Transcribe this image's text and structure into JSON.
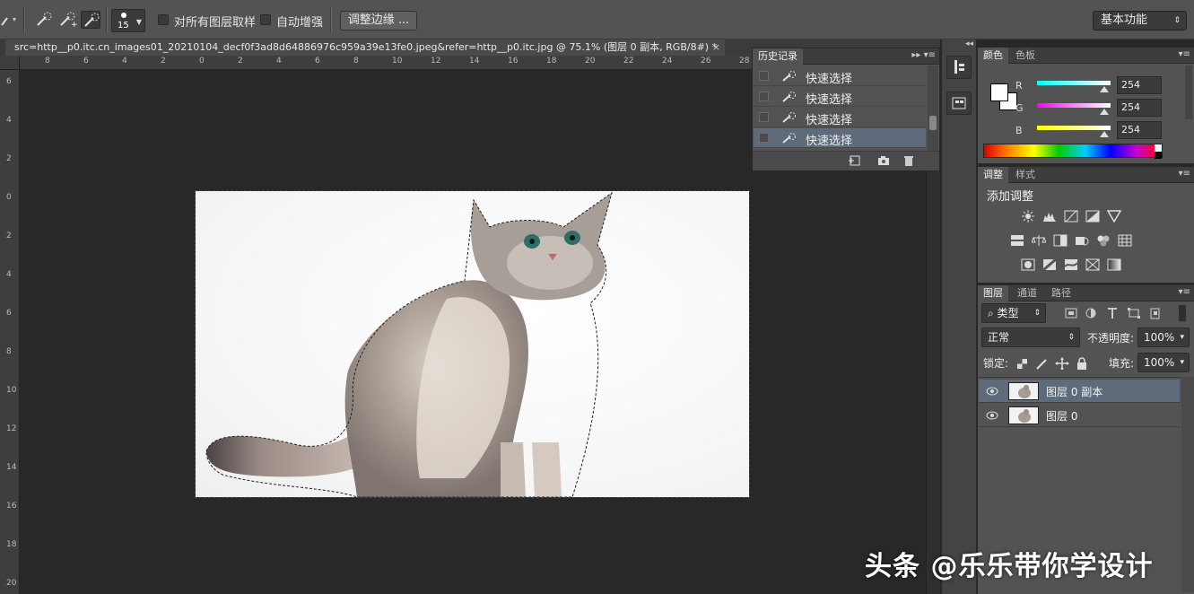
{
  "options_bar": {
    "brush_size": "15",
    "sample_all_layers_label": "对所有图层取样",
    "auto_enhance_label": "自动增强",
    "refine_edge_label": "调整边缘 ...",
    "workspace_label": "基本功能"
  },
  "document": {
    "tab_title": "src=http__p0.itc.cn_images01_20210104_decf0f3ad8d64886976c959a39e13fe0.jpeg&refer=http__p0.itc.jpg @ 75.1% (图层 0 副本, RGB/8#) *",
    "close_glyph": "×",
    "ruler_h": [
      "8",
      "6",
      "4",
      "2",
      "0",
      "2",
      "4",
      "6",
      "8",
      "10",
      "12",
      "14",
      "16",
      "18",
      "20",
      "22",
      "24",
      "26",
      "28"
    ],
    "ruler_v": [
      "6",
      "4",
      "2",
      "0",
      "2",
      "4",
      "6",
      "8",
      "10",
      "12",
      "14",
      "16",
      "18",
      "20"
    ]
  },
  "history": {
    "tab_label": "历史记录",
    "items": [
      "快速选择",
      "快速选择",
      "快速选择",
      "快速选择"
    ],
    "selected_index": 3
  },
  "color": {
    "tabs": [
      "颜色",
      "色板"
    ],
    "channels": [
      {
        "name": "R",
        "value": "254"
      },
      {
        "name": "G",
        "value": "254"
      },
      {
        "name": "B",
        "value": "254"
      }
    ]
  },
  "adjustments": {
    "tabs": [
      "调整",
      "样式"
    ],
    "title": "添加调整"
  },
  "layers": {
    "tabs": [
      "图层",
      "通道",
      "路径"
    ],
    "filter_label": "类型",
    "blend_mode": "正常",
    "opacity_label": "不透明度:",
    "opacity_value": "100%",
    "lock_label": "锁定:",
    "fill_label": "填充:",
    "fill_value": "100%",
    "items": [
      {
        "name": "图层 0 副本",
        "selected": true
      },
      {
        "name": "图层 0",
        "selected": false
      }
    ]
  },
  "watermark": "头条 @乐乐带你学设计"
}
